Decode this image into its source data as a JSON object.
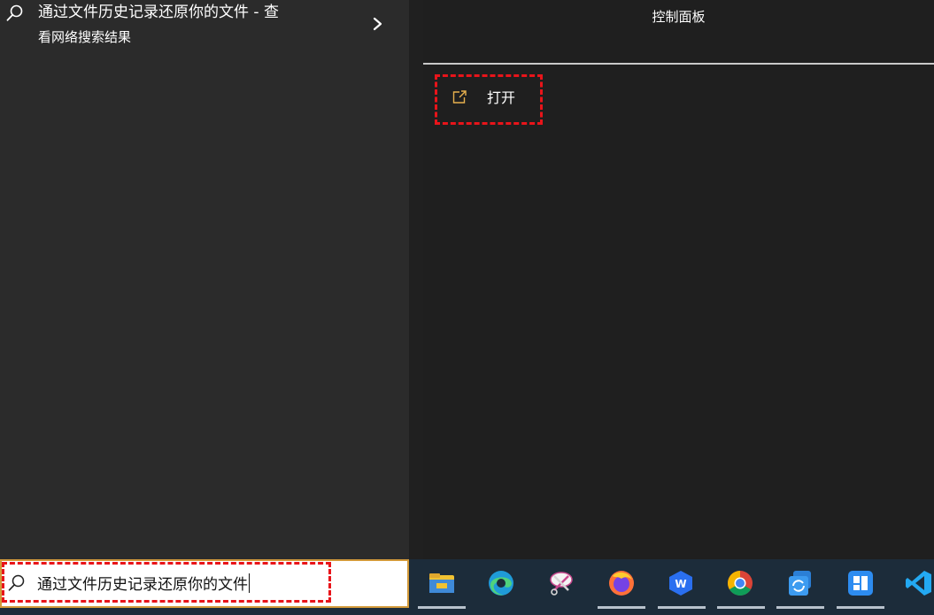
{
  "search_results": {
    "top_result": {
      "title": "通过文件历史记录还原你的文件",
      "suffix": " - 查",
      "subtitle": "看网络搜索结果",
      "icon": "search-icon",
      "expand_icon": "chevron-right-icon"
    }
  },
  "details": {
    "title": "控制面板",
    "actions": [
      {
        "label": "打开",
        "icon": "open-external-icon"
      }
    ]
  },
  "taskbar": {
    "search_value": "通过文件历史记录还原你的文件",
    "search_icon": "search-icon",
    "apps": [
      {
        "name": "file-explorer-icon"
      },
      {
        "name": "edge-icon"
      },
      {
        "name": "snipping-tool-icon"
      },
      {
        "name": "firefox-icon"
      },
      {
        "name": "wps-icon"
      },
      {
        "name": "chrome-icon"
      },
      {
        "name": "sync-app-icon"
      },
      {
        "name": "feishu-icon"
      },
      {
        "name": "vscode-icon"
      }
    ]
  },
  "colors": {
    "highlight_dash": "#e8141a",
    "search_border": "#d39a3a",
    "taskbar_bg": "#1c2c3a"
  }
}
